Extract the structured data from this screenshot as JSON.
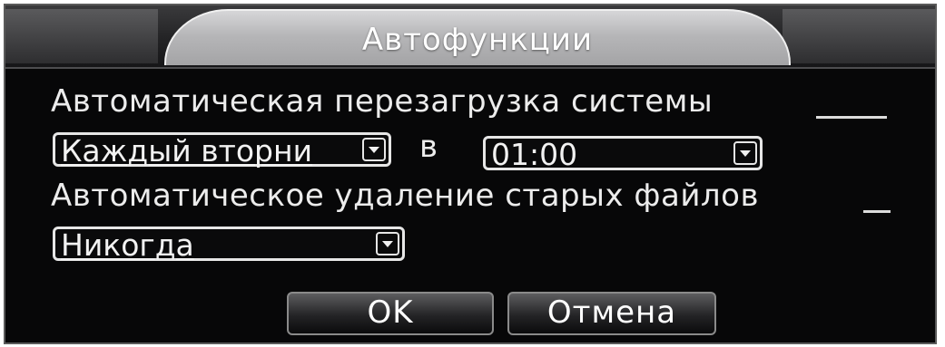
{
  "window": {
    "title": "Автофункции"
  },
  "auto_reboot": {
    "label": "Автоматическая перезагрузка системы",
    "day_value": "Каждый вторни",
    "at_label": "в",
    "time_value": "01:00"
  },
  "auto_delete": {
    "label": "Автоматическое удаление старых файлов",
    "value": "Никогда"
  },
  "buttons": {
    "ok": "OK",
    "cancel": "Отмена"
  }
}
